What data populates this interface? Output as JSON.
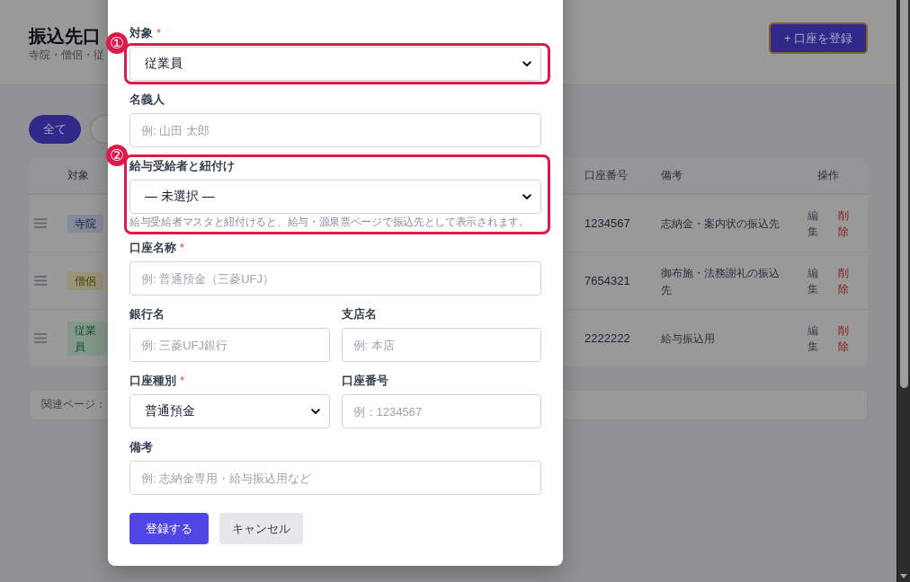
{
  "page": {
    "title": "振込先口",
    "subtitle": "寺院・僧侶・従",
    "add_button": "+ 口座を登録",
    "filters": [
      {
        "label": "全て",
        "selected": true
      },
      {
        "selected": false
      }
    ]
  },
  "table": {
    "columns": [
      "対象",
      "口座番号",
      "備考",
      "操作"
    ],
    "rows": [
      {
        "tag": {
          "label": "寺院",
          "color": "#868b99"
        },
        "account_number": "1234567",
        "note": "志納金・案内状の振込先",
        "actions": [
          {
            "label": "編集",
            "kind": "edit"
          },
          {
            "label": "削除",
            "kind": "delete"
          }
        ]
      },
      {
        "tag": {
          "label": "僧侶",
          "color": "#989277"
        },
        "account_number": "7654321",
        "note": "御布施・法務謝礼の振込先",
        "actions": [
          {
            "label": "編集",
            "kind": "edit"
          },
          {
            "label": "削除",
            "kind": "delete"
          }
        ]
      },
      {
        "tag": {
          "label": "従業員",
          "color": "#84978b"
        },
        "account_number": "2222222",
        "note": "給与振込用",
        "actions": [
          {
            "label": "編集",
            "kind": "edit"
          },
          {
            "label": "削除",
            "kind": "delete"
          }
        ]
      }
    ]
  },
  "related": {
    "label": "関連ページ："
  },
  "dialog": {
    "rows": [
      {
        "fields": [
          {
            "kind": "select",
            "label": "対象",
            "required_mark": "*",
            "value": "従業員",
            "annotation": {
              "number": "①",
              "covers_label": false
            }
          }
        ]
      },
      {
        "fields": [
          {
            "kind": "text",
            "label": "名義人",
            "placeholder": "例: 山田 太郎"
          }
        ]
      },
      {
        "fields": [
          {
            "kind": "select",
            "label": "給与受給者と紐付け",
            "value": "— 未選択 —",
            "help": "給与受給者マスタと紐付けると、給与・源泉票ページで振込先として表示されます。",
            "annotation": {
              "number": "②",
              "covers_label": true
            }
          }
        ]
      },
      {
        "fields": [
          {
            "kind": "text",
            "label": "口座名称",
            "required_mark": "*",
            "placeholder": "例: 普通預金（三菱UFJ）"
          }
        ]
      },
      {
        "fields": [
          {
            "kind": "text",
            "label": "銀行名",
            "placeholder": "例: 三菱UFJ銀行"
          },
          {
            "kind": "text",
            "label": "支店名",
            "placeholder": "例: 本店"
          }
        ]
      },
      {
        "fields": [
          {
            "kind": "select",
            "label": "口座種別",
            "required_mark": "*",
            "value": "普通預金"
          },
          {
            "kind": "text",
            "label": "口座番号",
            "placeholder": "例：1234567"
          }
        ]
      },
      {
        "fields": [
          {
            "kind": "text",
            "label": "備考",
            "placeholder": "例: 志納金専用・給与振込用など"
          }
        ]
      }
    ],
    "buttons": [
      {
        "label": "登録する",
        "kind": "primary"
      },
      {
        "label": "キャンセル",
        "kind": "secondary"
      }
    ]
  }
}
